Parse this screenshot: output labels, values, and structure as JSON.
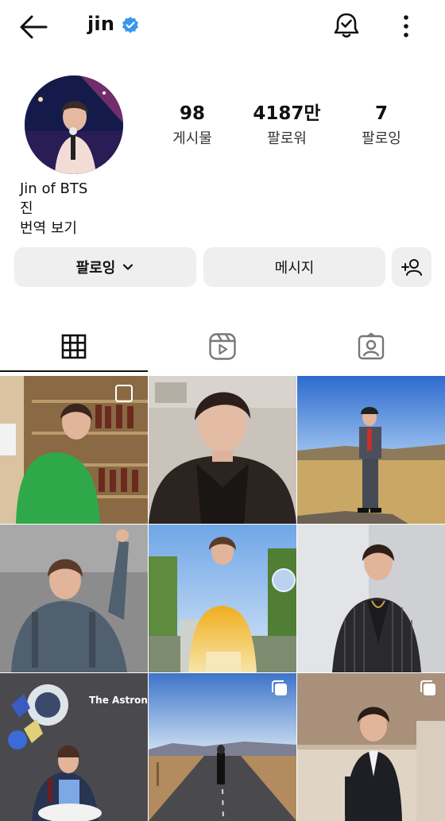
{
  "header": {
    "username": "jin",
    "icons": {
      "back": "arrow-left-icon",
      "verified": "verified-badge-icon",
      "notifications": "bell-check-icon",
      "more": "more-vertical-icon"
    }
  },
  "profile": {
    "stats": [
      {
        "value": "98",
        "label": "게시물"
      },
      {
        "value": "4187만",
        "label": "팔로워"
      },
      {
        "value": "7",
        "label": "팔로잉"
      }
    ],
    "bio": {
      "name": "Jin of BTS",
      "line2": "진",
      "translate": "번역 보기"
    }
  },
  "actions": {
    "following_label": "팔로잉",
    "message_label": "메시지",
    "suggest_icon": "add-person-icon"
  },
  "tabs": [
    {
      "icon": "grid-icon",
      "selected": true
    },
    {
      "icon": "reels-icon",
      "selected": false
    },
    {
      "icon": "tagged-icon",
      "selected": false
    }
  ],
  "posts": [
    {
      "description": "green sweater, shop shelves",
      "multi": true
    },
    {
      "description": "black jacket selfie",
      "multi": false
    },
    {
      "description": "suit in field, blue sky",
      "multi": false
    },
    {
      "description": "denim jacket, arm raised",
      "multi": false
    },
    {
      "description": "yellow sweater outdoors",
      "multi": false
    },
    {
      "description": "striped blazer, gray wall",
      "multi": false
    },
    {
      "description": "The Astronaut balloons",
      "multi": false,
      "caption": "The Astronaut"
    },
    {
      "description": "walking on road",
      "multi": true
    },
    {
      "description": "black suit, sitting",
      "multi": true
    }
  ],
  "colors": {
    "verified": "#3797f0",
    "button_bg": "#efefef",
    "text": "#111111"
  }
}
